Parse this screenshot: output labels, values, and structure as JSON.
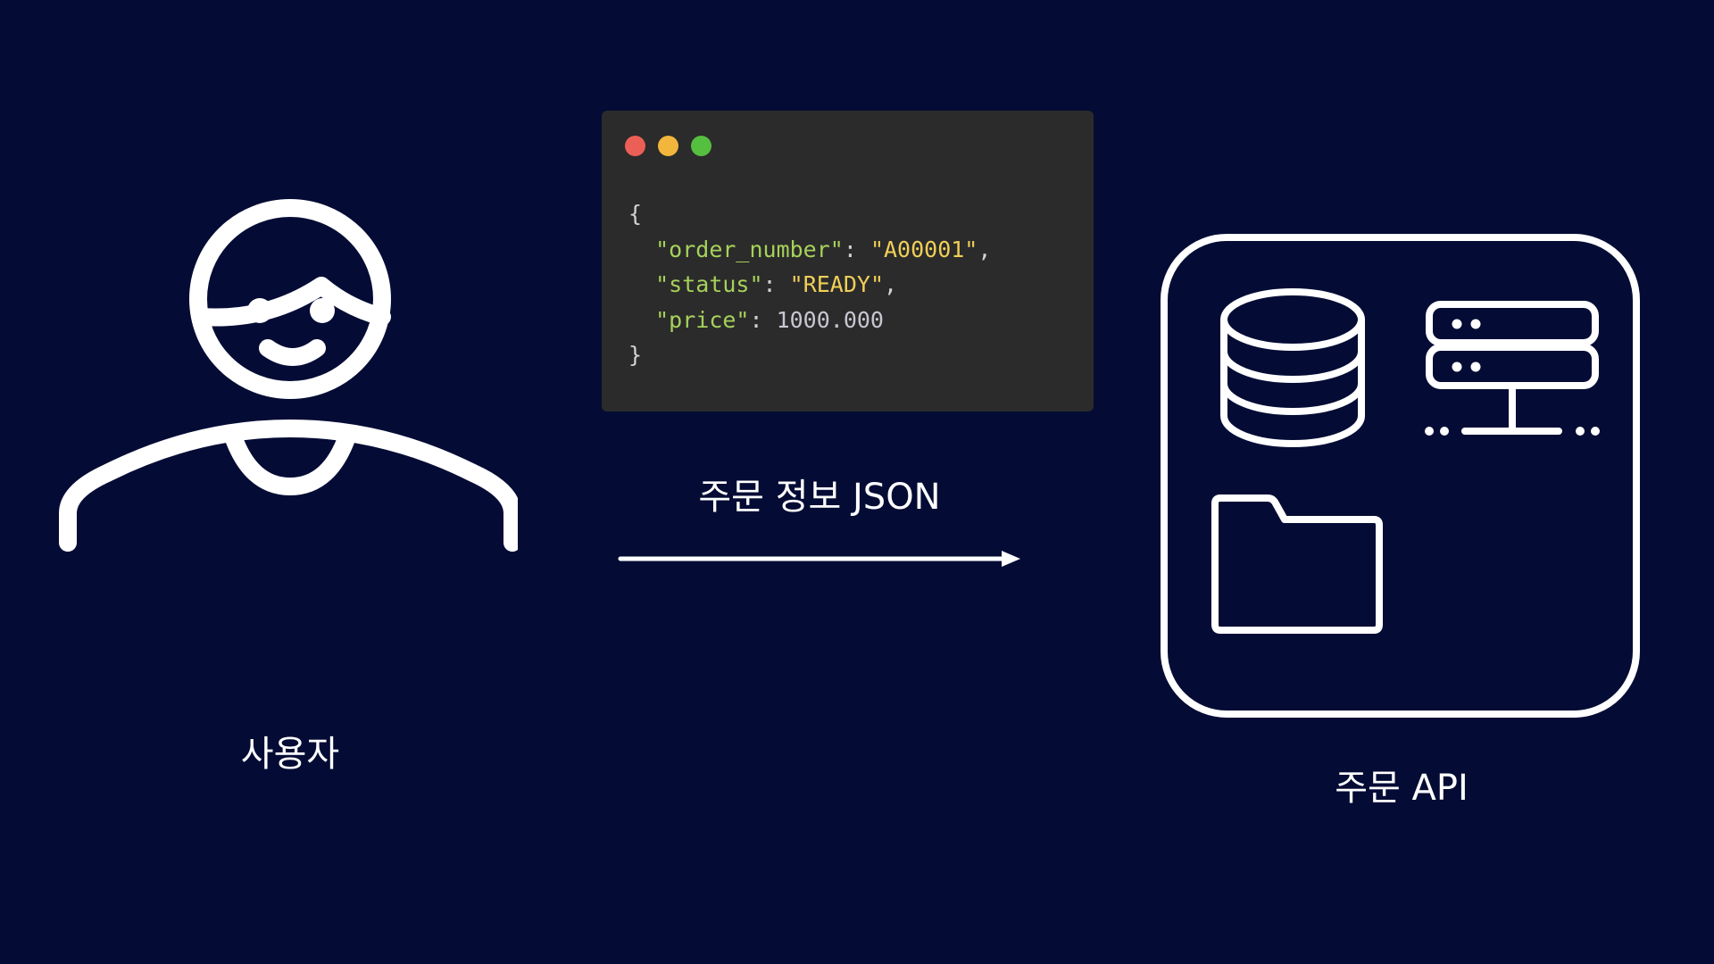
{
  "user": {
    "label": "사용자",
    "icon": "user-icon"
  },
  "payload": {
    "label": "주문 정보 JSON",
    "window_controls": [
      "close",
      "minimize",
      "maximize"
    ],
    "colors": {
      "background": "#2b2b2b",
      "close": "#ec5f56",
      "minimize": "#f2b63c",
      "maximize": "#55bf40",
      "key": "#a6d15a",
      "string": "#f0cf57",
      "number": "#c7c7d1"
    },
    "json": {
      "open": "{",
      "close": "}",
      "fields": [
        {
          "key": "\"order_number\"",
          "value": "\"A00001\"",
          "suffix": ","
        },
        {
          "key": "\"status\"",
          "value": "\"READY\"",
          "suffix": ","
        },
        {
          "key": "\"price\"",
          "value": "1000.000",
          "suffix": ""
        }
      ]
    }
  },
  "flow": {
    "arrow": "arrow-right"
  },
  "api": {
    "label": "주문 API",
    "icons": [
      "database-icon",
      "server-icon",
      "folder-icon"
    ]
  },
  "colors": {
    "background": "#040c35",
    "foreground": "#ffffff"
  }
}
